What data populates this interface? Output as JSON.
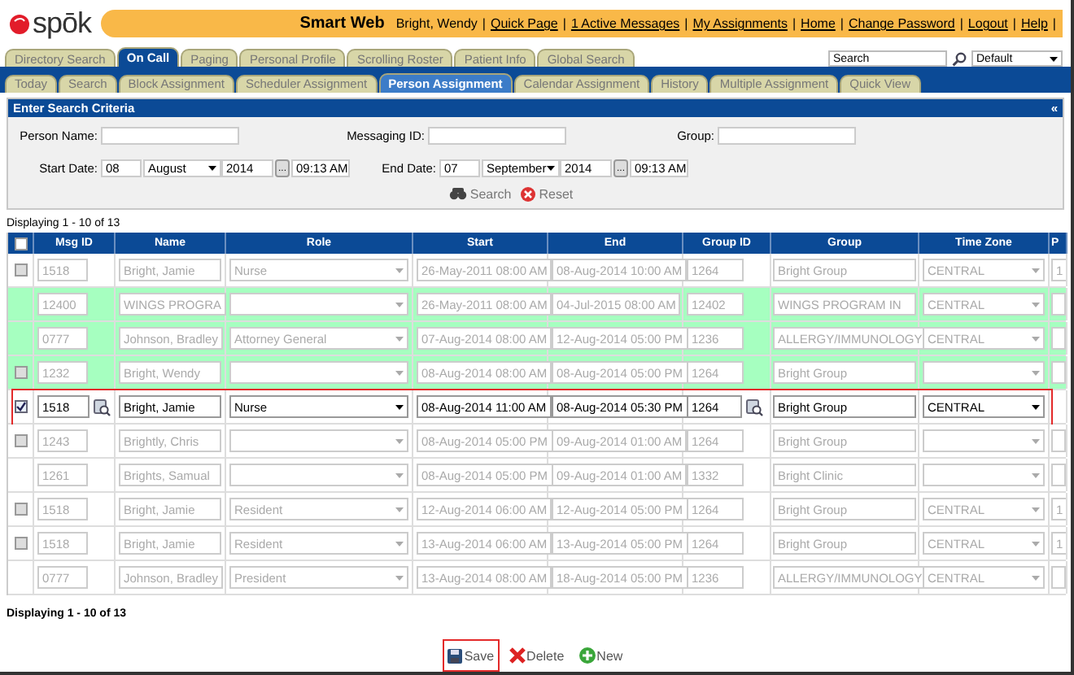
{
  "header": {
    "logo": "spōk",
    "app_title": "Smart Web",
    "user": "Bright, Wendy",
    "separator": "|",
    "links": [
      "Quick Page",
      "1 Active Messages",
      "My Assignments",
      "Home",
      "Change Password",
      "Logout",
      "Help"
    ]
  },
  "tabs": [
    {
      "label": "Directory Search",
      "selected": false
    },
    {
      "label": "On Call",
      "selected": true
    },
    {
      "label": "Paging",
      "selected": false
    },
    {
      "label": "Personal Profile",
      "selected": false
    },
    {
      "label": "Scrolling Roster",
      "selected": false
    },
    {
      "label": "Patient Info",
      "selected": false
    },
    {
      "label": "Global Search",
      "selected": false
    }
  ],
  "search": {
    "value": "Search",
    "scope": "Default"
  },
  "subtabs": [
    {
      "label": "Today",
      "selected": false
    },
    {
      "label": "Search",
      "selected": false
    },
    {
      "label": "Block Assignment",
      "selected": false
    },
    {
      "label": "Scheduler Assignment",
      "selected": false
    },
    {
      "label": "Person Assignment",
      "selected": true
    },
    {
      "label": "Calendar Assignment",
      "selected": false
    },
    {
      "label": "History",
      "selected": false
    },
    {
      "label": "Multiple Assignment",
      "selected": false
    },
    {
      "label": "Quick View",
      "selected": false
    }
  ],
  "criteria": {
    "title": "Enter Search Criteria",
    "collapse": "«",
    "person_name_label": "Person Name:",
    "messaging_id_label": "Messaging ID:",
    "group_label": "Group:",
    "start_label": "Start Date:",
    "start_day": "08",
    "start_month": "August",
    "start_year": "2014",
    "start_time": "09:13 AM",
    "end_label": "End Date:",
    "end_day": "07",
    "end_month": "September",
    "end_year": "2014",
    "end_time": "09:13 AM",
    "picker": "...",
    "search_button": "Search",
    "reset_button": "Reset"
  },
  "paging_top": "Displaying 1 - 10 of 13",
  "table": {
    "select_all_checked": false,
    "columns": [
      "Msg ID",
      "Name",
      "Role",
      "Start",
      "End",
      "Group ID",
      "Group",
      "Time Zone",
      "P"
    ],
    "rows": [
      {
        "has_checkbox": true,
        "checked": false,
        "highlighted": false,
        "selected": false,
        "msg_id": "1518",
        "name": "Bright, Jamie",
        "role": "Nurse",
        "start": "26-May-2011 08:00 AM",
        "end": "08-Aug-2014 10:00 AM",
        "group_id": "1264",
        "group": "Bright Group",
        "time_zone": "CENTRAL",
        "column_10": "1"
      },
      {
        "has_checkbox": false,
        "checked": false,
        "highlighted": true,
        "selected": false,
        "msg_id": "12400",
        "name": "WINGS PROGRA",
        "role": "",
        "start": "26-May-2011 08:00 AM",
        "end": "04-Jul-2015 08:00 AM",
        "group_id": "12402",
        "group": "WINGS PROGRAM IN",
        "time_zone": "CENTRAL"
      },
      {
        "has_checkbox": false,
        "checked": false,
        "highlighted": true,
        "selected": false,
        "msg_id": "0777",
        "name": "Johnson, Bradley",
        "role": "Attorney General",
        "start": "07-Aug-2014 08:00 AM",
        "end": "12-Aug-2014 05:00 PM",
        "group_id": "1236",
        "group": "ALLERGY/IMMUNOLOGY",
        "time_zone": "CENTRAL"
      },
      {
        "has_checkbox": true,
        "checked": false,
        "highlighted": true,
        "selected": false,
        "msg_id": "1232",
        "name": "Bright, Wendy",
        "role": "",
        "start": "08-Aug-2014 08:00 AM",
        "end": "08-Aug-2014 05:00 PM",
        "group_id": "1264",
        "group": "Bright Group",
        "time_zone": ""
      },
      {
        "has_checkbox": true,
        "checked": true,
        "highlighted": false,
        "selected": true,
        "msg_id": "1518",
        "name": "Bright, Jamie",
        "role": "Nurse",
        "start": "08-Aug-2014 11:00 AM",
        "end": "08-Aug-2014 05:30 PM",
        "group_id": "1264",
        "group": "Bright Group",
        "time_zone": "CENTRAL"
      },
      {
        "has_checkbox": true,
        "checked": false,
        "highlighted": false,
        "selected": false,
        "msg_id": "1243",
        "name": "Brightly, Chris",
        "role": "",
        "start": "08-Aug-2014 05:00 PM",
        "end": "09-Aug-2014 01:00 AM",
        "group_id": "1264",
        "group": "Bright Group",
        "time_zone": ""
      },
      {
        "has_checkbox": false,
        "checked": false,
        "highlighted": false,
        "selected": false,
        "msg_id": "1261",
        "name": "Brights, Samual",
        "role": "",
        "start": "08-Aug-2014 05:00 PM",
        "end": "09-Aug-2014 01:00 AM",
        "group_id": "1332",
        "group": "Bright Clinic",
        "time_zone": ""
      },
      {
        "has_checkbox": true,
        "checked": false,
        "highlighted": false,
        "selected": false,
        "msg_id": "1518",
        "name": "Bright, Jamie",
        "role": "Resident",
        "start": "12-Aug-2014 06:00 AM",
        "end": "12-Aug-2014 05:00 PM",
        "group_id": "1264",
        "group": "Bright Group",
        "time_zone": "CENTRAL",
        "column_10": "1"
      },
      {
        "has_checkbox": true,
        "checked": false,
        "highlighted": false,
        "selected": false,
        "msg_id": "1518",
        "name": "Bright, Jamie",
        "role": "Resident",
        "start": "13-Aug-2014 06:00 AM",
        "end": "13-Aug-2014 05:00 PM",
        "group_id": "1264",
        "group": "Bright Group",
        "time_zone": "CENTRAL",
        "column_10": "1"
      },
      {
        "has_checkbox": false,
        "checked": false,
        "highlighted": false,
        "selected": false,
        "msg_id": "0777",
        "name": "Johnson, Bradley",
        "role": "President",
        "start": "13-Aug-2014 08:00 AM",
        "end": "18-Aug-2014 05:00 PM",
        "group_id": "1236",
        "group": "ALLERGY/IMMUNOLOGY",
        "time_zone": "CENTRAL"
      }
    ]
  },
  "paging_bottom": "Displaying 1 - 10 of 13",
  "actions": [
    {
      "kind": "save",
      "label": "Save",
      "highlighted": true
    },
    {
      "kind": "delete",
      "label": "Delete",
      "highlighted": false
    },
    {
      "kind": "new",
      "label": "New",
      "highlighted": false
    }
  ]
}
